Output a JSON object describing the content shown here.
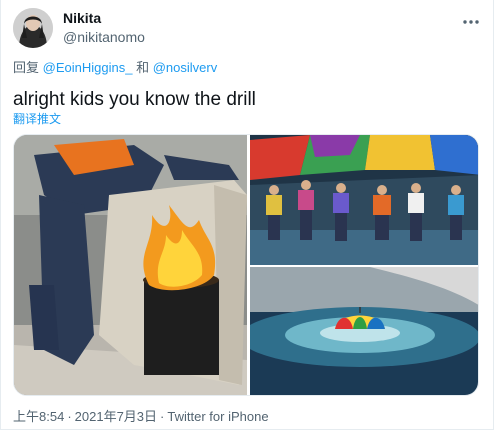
{
  "tweet": {
    "display_name": "Nikita",
    "handle": "@nikitanomo",
    "reply_prefix": "回复",
    "reply_mention_1": "@EoinHiggins_",
    "reply_and": "和",
    "reply_mention_2": "@nosilverv",
    "text": "alright kids you know the drill",
    "translate_label": "翻译推文",
    "time": "上午8:54",
    "date": "2021年7月3日",
    "separator": "·",
    "source": "Twitter for iPhone"
  },
  "icons": {
    "more": "more-horizontal-icon"
  },
  "colors": {
    "link": "#1d9bf0",
    "secondary_text": "#536471",
    "primary_text": "#0f1419"
  }
}
